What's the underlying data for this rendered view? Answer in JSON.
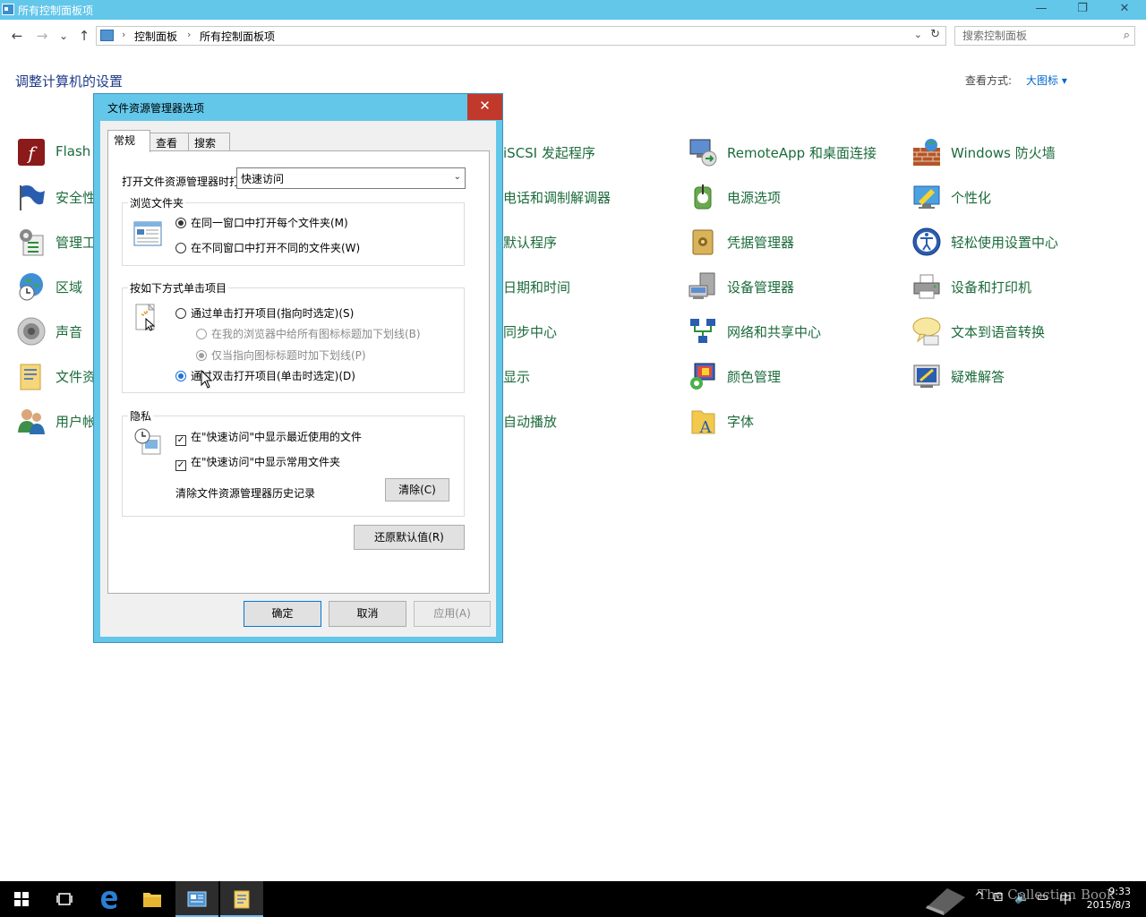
{
  "window": {
    "title": "所有控制面板项"
  },
  "nav": {
    "back": "←",
    "forward": "→",
    "recent": "⌄",
    "up": "↑",
    "breadcrumb": [
      "控制面板",
      "所有控制面板项"
    ],
    "search_placeholder": "搜索控制面板"
  },
  "header": {
    "title": "调整计算机的设置",
    "view_by_label": "查看方式:",
    "view_by_value": "大图标 ▾"
  },
  "items": {
    "col1": [
      "Flash",
      "安全性",
      "管理工",
      "区域",
      "声音",
      "文件资",
      "用户帐"
    ],
    "col3": [
      "iSCSI 发起程序",
      "电话和调制解调器",
      "默认程序",
      "日期和时间",
      "同步中心",
      "显示",
      "自动播放"
    ],
    "col4": [
      "RemoteApp 和桌面连接",
      "电源选项",
      "凭据管理器",
      "设备管理器",
      "网络和共享中心",
      "颜色管理",
      "字体"
    ],
    "col5": [
      "Windows 防火墙",
      "个性化",
      "轻松使用设置中心",
      "设备和打印机",
      "文本到语音转换",
      "疑难解答"
    ]
  },
  "dialog": {
    "title": "文件资源管理器选项",
    "close": "✕",
    "tabs": [
      "常规",
      "查看",
      "搜索"
    ],
    "open_label": "打开文件资源管理器时打",
    "open_value": "快速访问",
    "browse_group": {
      "title": "浏览文件夹",
      "options": [
        "在同一窗口中打开每个文件夹(M)",
        "在不同窗口中打开不同的文件夹(W)"
      ]
    },
    "click_group": {
      "title": "按如下方式单击项目",
      "single": "通过单击打开项目(指向时选定)(S)",
      "underline_all": "在我的浏览器中给所有图标标题加下划线(B)",
      "underline_hover": "仅当指向图标标题时加下划线(P)",
      "double": "通过双击打开项目(单击时选定)(D)"
    },
    "privacy_group": {
      "title": "隐私",
      "recent_files": "在\"快速访问\"中显示最近使用的文件",
      "frequent_folders": "在\"快速访问\"中显示常用文件夹",
      "clear_label": "清除文件资源管理器历史记录",
      "clear_button": "清除(C)"
    },
    "restore_button": "还原默认值(R)",
    "ok": "确定",
    "cancel": "取消",
    "apply": "应用(A)"
  },
  "taskbar": {
    "clock_time": "9:33",
    "clock_date": "2015/8/3",
    "ime": "中",
    "watermark": "The Collection Book"
  }
}
